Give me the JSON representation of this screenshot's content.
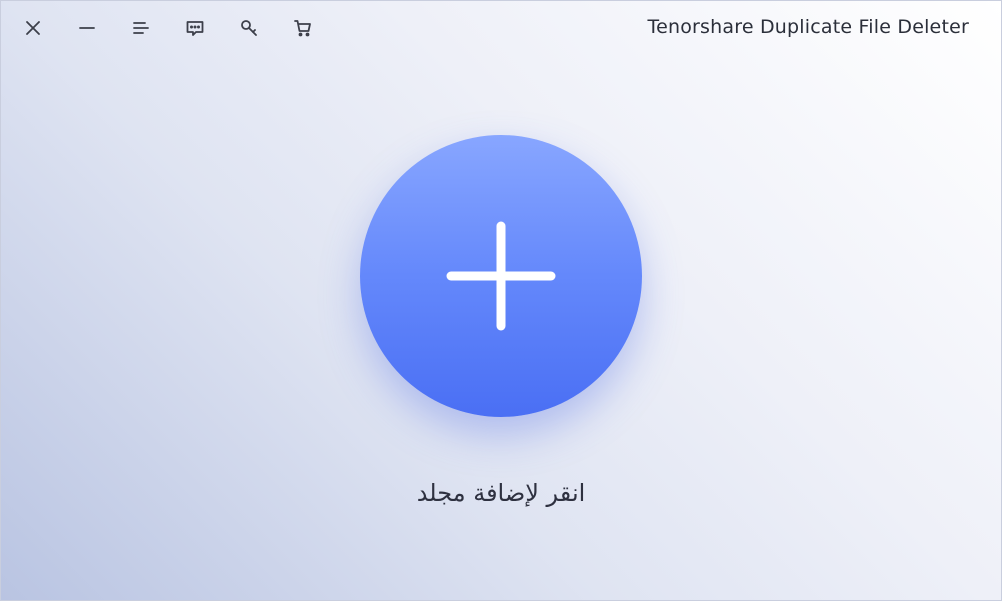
{
  "window": {
    "title": "Tenorshare Duplicate File Deleter"
  },
  "toolbar": {
    "icons": [
      "close-icon",
      "minimize-icon",
      "menu-icon",
      "feedback-icon",
      "key-icon",
      "cart-icon"
    ]
  },
  "main": {
    "add_folder_label": "انقر لإضافة مجلد",
    "add_icon": "plus-icon"
  },
  "colors": {
    "accent": "#5b7ff8",
    "accent_light": "#88a6ff",
    "text": "#2e3140"
  }
}
